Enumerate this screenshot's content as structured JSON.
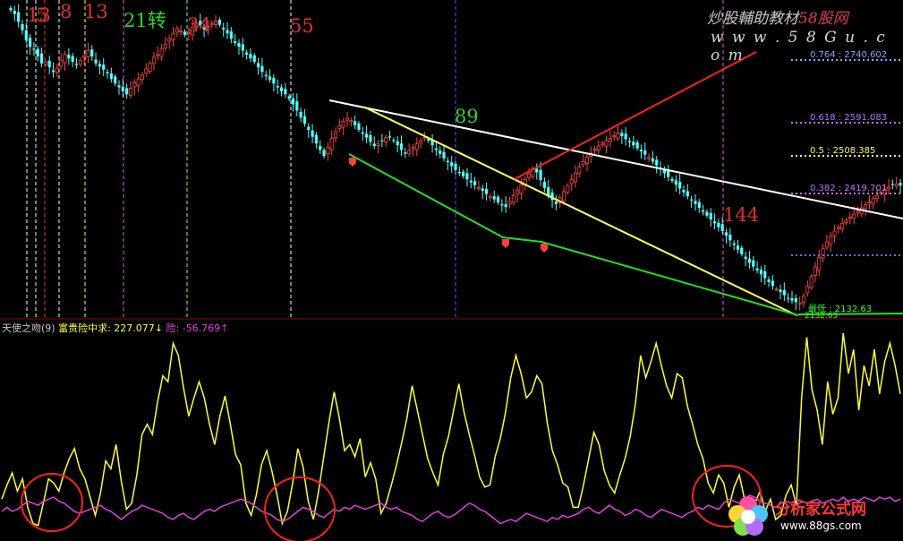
{
  "watermark": {
    "prefix": "炒股輔助教材",
    "brand": "58股网",
    "url": "w w w . 5 8 G u . c o m"
  },
  "fib_numbers": [
    {
      "text": "13",
      "color": "#e03030"
    },
    {
      "text": "5",
      "color": "#e03030"
    },
    {
      "text": "8",
      "color": "#e03030"
    },
    {
      "text": "13",
      "color": "#e03030"
    },
    {
      "text": "21转",
      "color": "#31d231"
    },
    {
      "text": "34",
      "color": "#e03030"
    },
    {
      "text": "55",
      "color": "#e03030"
    },
    {
      "text": "89",
      "color": "#31d231"
    },
    {
      "text": "144",
      "color": "#e03030"
    }
  ],
  "fib_levels": [
    {
      "ratio": "0.764",
      "value": "2740.602",
      "color": "#8aa0ff"
    },
    {
      "ratio": "0.618",
      "value": "2591.083",
      "color": "#c070ff"
    },
    {
      "ratio": "0.5",
      "value": "2508.385",
      "color": "#ffff33"
    },
    {
      "ratio": "0.382",
      "value": "2419.701",
      "color": "#c070ff"
    },
    {
      "ratio": "最低",
      "value": "2132.63",
      "color": "#33ff33"
    }
  ],
  "low_label": "2132.63",
  "indicator": {
    "name": "天使之吻(9)",
    "line1_label": "富贵险中求",
    "line1_value": "227.077",
    "line1_arrow": "↓",
    "line2_label": "险",
    "line2_value": "-56.769",
    "line2_arrow": "↑"
  },
  "logo": {
    "name": "分析家公式网",
    "url": "www.88gs.com"
  },
  "chart_data": [
    {
      "type": "candlestick",
      "title": "",
      "fib_time_numbers": [
        "13",
        "5",
        "8",
        "13",
        "21转",
        "34",
        "55",
        "89",
        "144"
      ],
      "fib_price_levels": [
        {
          "ratio": 0.764,
          "value": 2740.602
        },
        {
          "ratio": 0.618,
          "value": 2591.083
        },
        {
          "ratio": 0.5,
          "value": 2508.385
        },
        {
          "ratio": 0.382,
          "value": 2419.701
        },
        {
          "ratio": "最低",
          "value": 2132.63
        }
      ],
      "ylim": [
        2100,
        2900
      ],
      "closes": [
        2890,
        2880,
        2860,
        2838,
        2812,
        2795,
        2788,
        2770,
        2752,
        2756,
        2742,
        2730,
        2740,
        2760,
        2775,
        2765,
        2756,
        2748,
        2760,
        2772,
        2785,
        2770,
        2752,
        2744,
        2736,
        2726,
        2712,
        2700,
        2690,
        2680,
        2672,
        2688,
        2702,
        2712,
        2722,
        2738,
        2752,
        2768,
        2775,
        2790,
        2802,
        2816,
        2830,
        2842,
        2836,
        2826,
        2832,
        2846,
        2856,
        2850,
        2840,
        2848,
        2856,
        2862,
        2852,
        2840,
        2830,
        2816,
        2805,
        2795,
        2785,
        2775,
        2765,
        2756,
        2742,
        2730,
        2720,
        2710,
        2700,
        2690,
        2680,
        2672,
        2660,
        2646,
        2630,
        2612,
        2596,
        2580,
        2562,
        2545,
        2528,
        2512,
        2534,
        2558,
        2575,
        2590,
        2602,
        2610,
        2604,
        2592,
        2580,
        2570,
        2560,
        2549,
        2538,
        2545,
        2552,
        2560,
        2562,
        2552,
        2540,
        2528,
        2518,
        2526,
        2534,
        2544,
        2552,
        2560,
        2552,
        2540,
        2528,
        2518,
        2506,
        2496,
        2486,
        2476,
        2470,
        2460,
        2452,
        2444,
        2437,
        2430,
        2422,
        2414,
        2408,
        2400,
        2392,
        2386,
        2380,
        2395,
        2410,
        2424,
        2438,
        2452,
        2466,
        2480,
        2470,
        2450,
        2430,
        2410,
        2398,
        2388,
        2404,
        2420,
        2436,
        2452,
        2468,
        2484,
        2498,
        2510,
        2520,
        2530,
        2538,
        2546,
        2552,
        2558,
        2565,
        2572,
        2564,
        2556,
        2548,
        2540,
        2532,
        2524,
        2516,
        2508,
        2498,
        2488,
        2478,
        2468,
        2458,
        2448,
        2438,
        2428,
        2418,
        2408,
        2398,
        2388,
        2378,
        2368,
        2358,
        2348,
        2338,
        2328,
        2318,
        2306,
        2294,
        2282,
        2270,
        2258,
        2246,
        2236,
        2226,
        2216,
        2206,
        2196,
        2186,
        2176,
        2168,
        2160,
        2152,
        2144,
        2138,
        2134,
        2132,
        2150,
        2175,
        2200,
        2225,
        2250,
        2272,
        2290,
        2306,
        2318,
        2328,
        2338,
        2346,
        2354,
        2362,
        2370,
        2378,
        2386,
        2394,
        2402,
        2410,
        2418,
        2426,
        2432,
        2438,
        2440,
        2436
      ]
    },
    {
      "type": "line",
      "title": "天使之吻(9)",
      "series": [
        {
          "name": "富贵险中求",
          "color": "#ffff33",
          "last": 227.077,
          "values": [
            0.18,
            0.25,
            0.31,
            0.22,
            0.28,
            0.14,
            0.06,
            0.05,
            0.16,
            0.28,
            0.26,
            0.22,
            0.31,
            0.38,
            0.43,
            0.33,
            0.28,
            0.19,
            0.1,
            0.21,
            0.37,
            0.33,
            0.45,
            0.27,
            0.13,
            0.16,
            0.3,
            0.5,
            0.55,
            0.5,
            0.66,
            0.79,
            0.76,
            0.95,
            0.89,
            0.73,
            0.59,
            0.68,
            0.76,
            0.68,
            0.55,
            0.45,
            0.59,
            0.69,
            0.55,
            0.4,
            0.35,
            0.16,
            0.1,
            0.2,
            0.35,
            0.42,
            0.32,
            0.2,
            0.06,
            0.12,
            0.26,
            0.43,
            0.34,
            0.17,
            0.08,
            0.22,
            0.39,
            0.56,
            0.71,
            0.58,
            0.42,
            0.45,
            0.39,
            0.48,
            0.29,
            0.36,
            0.28,
            0.11,
            0.16,
            0.25,
            0.35,
            0.46,
            0.58,
            0.74,
            0.62,
            0.5,
            0.38,
            0.31,
            0.25,
            0.4,
            0.49,
            0.62,
            0.75,
            0.61,
            0.5,
            0.4,
            0.29,
            0.24,
            0.25,
            0.39,
            0.48,
            0.61,
            0.78,
            0.89,
            0.8,
            0.68,
            0.71,
            0.79,
            0.75,
            0.56,
            0.42,
            0.35,
            0.26,
            0.24,
            0.14,
            0.14,
            0.25,
            0.38,
            0.51,
            0.45,
            0.32,
            0.25,
            0.21,
            0.3,
            0.38,
            0.49,
            0.65,
            0.89,
            0.78,
            0.86,
            0.95,
            0.84,
            0.74,
            0.68,
            0.8,
            0.78,
            0.64,
            0.55,
            0.45,
            0.38,
            0.26,
            0.21,
            0.3,
            0.26,
            0.14,
            0.24,
            0.3,
            0.18,
            0.08,
            0.16,
            0.22,
            0.12,
            0.18,
            0.08,
            0.1,
            0.2,
            0.25,
            0.15,
            0.68,
            0.98,
            0.72,
            0.62,
            0.45,
            0.76,
            0.6,
            0.68,
            1.0,
            0.8,
            0.92,
            0.62,
            0.84,
            0.74,
            0.92,
            0.7,
            0.86,
            0.95,
            0.84,
            0.7
          ]
        },
        {
          "name": "险",
          "color": "#e040e0",
          "last": -56.769,
          "values": [
            0.12,
            0.14,
            0.12,
            0.13,
            0.15,
            0.17,
            0.16,
            0.15,
            0.17,
            0.18,
            0.19,
            0.17,
            0.16,
            0.14,
            0.12,
            0.11,
            0.12,
            0.13,
            0.14,
            0.15,
            0.13,
            0.12,
            0.1,
            0.08,
            0.1,
            0.12,
            0.13,
            0.15,
            0.14,
            0.13,
            0.12,
            0.11,
            0.09,
            0.08,
            0.1,
            0.11,
            0.09,
            0.08,
            0.1,
            0.12,
            0.13,
            0.12,
            0.14,
            0.15,
            0.16,
            0.17,
            0.18,
            0.17,
            0.16,
            0.14,
            0.12,
            0.11,
            0.1,
            0.08,
            0.07,
            0.08,
            0.1,
            0.12,
            0.14,
            0.13,
            0.12,
            0.1,
            0.09,
            0.11,
            0.13,
            0.12,
            0.14,
            0.13,
            0.15,
            0.14,
            0.13,
            0.14,
            0.15,
            0.16,
            0.14,
            0.13,
            0.14,
            0.12,
            0.11,
            0.1,
            0.08,
            0.07,
            0.09,
            0.11,
            0.12,
            0.1,
            0.09,
            0.1,
            0.12,
            0.14,
            0.16,
            0.15,
            0.13,
            0.12,
            0.1,
            0.08,
            0.06,
            0.07,
            0.08,
            0.07,
            0.09,
            0.11,
            0.1,
            0.09,
            0.08,
            0.07,
            0.09,
            0.08,
            0.1,
            0.09,
            0.1,
            0.11,
            0.13,
            0.14,
            0.12,
            0.11,
            0.13,
            0.15,
            0.13,
            0.12,
            0.1,
            0.11,
            0.13,
            0.12,
            0.1,
            0.09,
            0.11,
            0.13,
            0.12,
            0.11,
            0.1,
            0.09,
            0.11,
            0.12,
            0.14,
            0.13,
            0.15,
            0.14,
            0.13,
            0.16,
            0.18,
            0.17,
            0.16,
            0.18,
            0.2,
            0.19,
            0.17,
            0.16,
            0.15,
            0.14,
            0.16,
            0.17,
            0.16,
            0.18,
            0.17,
            0.16,
            0.17,
            0.18,
            0.16,
            0.17,
            0.18,
            0.17,
            0.19,
            0.17,
            0.18,
            0.17,
            0.19,
            0.18,
            0.17,
            0.19,
            0.18,
            0.19,
            0.17,
            0.18
          ]
        }
      ]
    }
  ]
}
